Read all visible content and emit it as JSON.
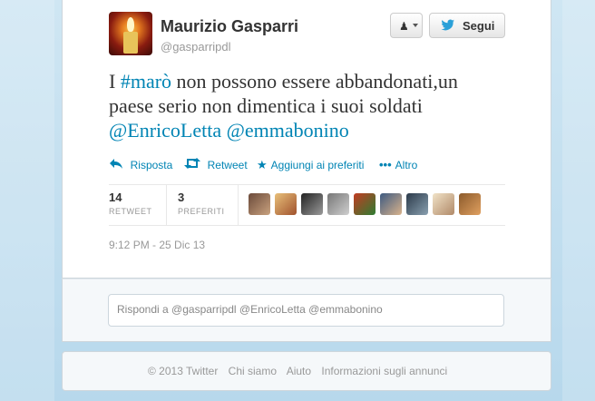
{
  "author": {
    "name": "Maurizio Gasparri",
    "handle": "@gasparripdl"
  },
  "buttons": {
    "user_icon": "user-dropdown-icon",
    "follow_label": "Segui"
  },
  "tweet": {
    "prefix": "I ",
    "hashtag": "#marò",
    "line1_rest": " non possono essere abbandonati,un",
    "line2": "paese serio non dimentica i suoi soldati",
    "mention1": "@EnricoLetta",
    "mention2": "@emmabonino"
  },
  "actions": {
    "reply": "Risposta",
    "retweet": "Retweet",
    "favorite": "Aggiungi ai preferiti",
    "more": "Altro"
  },
  "stats": {
    "retweets_count": "14",
    "retweets_label": "RETWEET",
    "favorites_count": "3",
    "favorites_label": "PREFERITI"
  },
  "timestamp": "9:12 PM - 25 Dic 13",
  "reply": {
    "placeholder": "Rispondi a @gasparripdl @EnricoLetta @emmabonino"
  },
  "footer": {
    "copyright": "© 2013 Twitter",
    "about": "Chi siamo",
    "help": "Aiuto",
    "ads": "Informazioni sugli annunci"
  },
  "colors": {
    "link": "#0084b4",
    "background": "#c0deed"
  }
}
